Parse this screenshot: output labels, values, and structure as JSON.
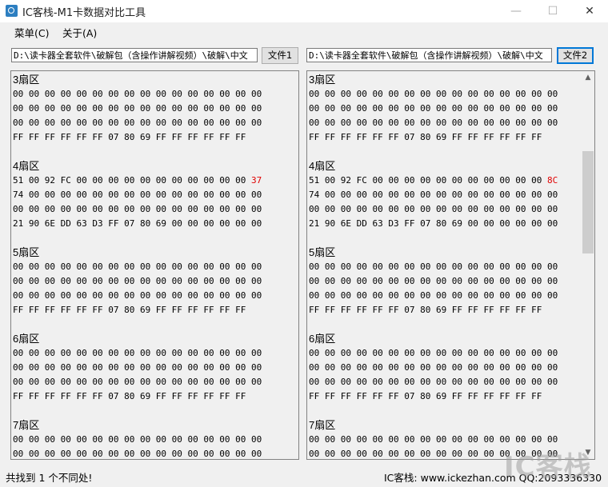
{
  "window": {
    "title": "IC客栈-M1卡数据对比工具",
    "minimize": "—",
    "maximize": "☐",
    "close": "✕"
  },
  "menu": {
    "items": [
      "菜单(C)",
      "关于(A)"
    ]
  },
  "left": {
    "path": "D:\\读卡器全套软件\\破解包（含操作讲解视频）\\破解\\中文",
    "file_button": "文件1",
    "sectors": [
      {
        "title": "3扇区",
        "rows": [
          "00 00 00 00 00 00 00 00 00 00 00 00 00 00 00 00",
          "00 00 00 00 00 00 00 00 00 00 00 00 00 00 00 00",
          "00 00 00 00 00 00 00 00 00 00 00 00 00 00 00 00",
          "FF FF FF FF FF FF 07 80 69 FF FF FF FF FF FF"
        ]
      },
      {
        "title": "4扇区",
        "rows": [
          "51 00 92 FC 00 00 00 00 00 00 00 00 00 00 00",
          "74 00 00 00 00 00 00 00 00 00 00 00 00 00 00 00",
          "00 00 00 00 00 00 00 00 00 00 00 00 00 00 00 00",
          "21 90 6E DD 63 D3 FF 07 80 69 00 00 00 00 00 00"
        ],
        "diff": "37"
      },
      {
        "title": "5扇区",
        "rows": [
          "00 00 00 00 00 00 00 00 00 00 00 00 00 00 00 00",
          "00 00 00 00 00 00 00 00 00 00 00 00 00 00 00 00",
          "00 00 00 00 00 00 00 00 00 00 00 00 00 00 00 00",
          "FF FF FF FF FF FF 07 80 69 FF FF FF FF FF FF"
        ]
      },
      {
        "title": "6扇区",
        "rows": [
          "00 00 00 00 00 00 00 00 00 00 00 00 00 00 00 00",
          "00 00 00 00 00 00 00 00 00 00 00 00 00 00 00 00",
          "00 00 00 00 00 00 00 00 00 00 00 00 00 00 00 00",
          "FF FF FF FF FF FF 07 80 69 FF FF FF FF FF FF"
        ]
      },
      {
        "title": "7扇区",
        "rows": [
          "00 00 00 00 00 00 00 00 00 00 00 00 00 00 00 00",
          "00 00 00 00 00 00 00 00 00 00 00 00 00 00 00 00"
        ]
      }
    ]
  },
  "right": {
    "path": "D:\\读卡器全套软件\\破解包（含操作讲解视频）\\破解\\中文",
    "file_button": "文件2",
    "sectors": [
      {
        "title": "3扇区",
        "rows": [
          "00 00 00 00 00 00 00 00 00 00 00 00 00 00 00 00",
          "00 00 00 00 00 00 00 00 00 00 00 00 00 00 00 00",
          "00 00 00 00 00 00 00 00 00 00 00 00 00 00 00 00",
          "FF FF FF FF FF FF 07 80 69 FF FF FF FF FF FF"
        ]
      },
      {
        "title": "4扇区",
        "rows": [
          "51 00 92 FC 00 00 00 00 00 00 00 00 00 00 00",
          "74 00 00 00 00 00 00 00 00 00 00 00 00 00 00 00",
          "00 00 00 00 00 00 00 00 00 00 00 00 00 00 00 00",
          "21 90 6E DD 63 D3 FF 07 80 69 00 00 00 00 00 00"
        ],
        "diff": "8C"
      },
      {
        "title": "5扇区",
        "rows": [
          "00 00 00 00 00 00 00 00 00 00 00 00 00 00 00 00",
          "00 00 00 00 00 00 00 00 00 00 00 00 00 00 00 00",
          "00 00 00 00 00 00 00 00 00 00 00 00 00 00 00 00",
          "FF FF FF FF FF FF 07 80 69 FF FF FF FF FF FF"
        ]
      },
      {
        "title": "6扇区",
        "rows": [
          "00 00 00 00 00 00 00 00 00 00 00 00 00 00 00 00",
          "00 00 00 00 00 00 00 00 00 00 00 00 00 00 00 00",
          "00 00 00 00 00 00 00 00 00 00 00 00 00 00 00 00",
          "FF FF FF FF FF FF 07 80 69 FF FF FF FF FF FF"
        ]
      },
      {
        "title": "7扇区",
        "rows": [
          "00 00 00 00 00 00 00 00 00 00 00 00 00 00 00 00",
          "00 00 00 00 00 00 00 00 00 00 00 00 00 00 00 00"
        ]
      }
    ]
  },
  "status": {
    "left": "共找到 1 个不同处!",
    "right": "IC客栈: www.ickezhan.com QQ:2093336330"
  },
  "watermark": "IC客栈",
  "colors": {
    "diff": "#e00000",
    "focus": "#0078d7"
  }
}
